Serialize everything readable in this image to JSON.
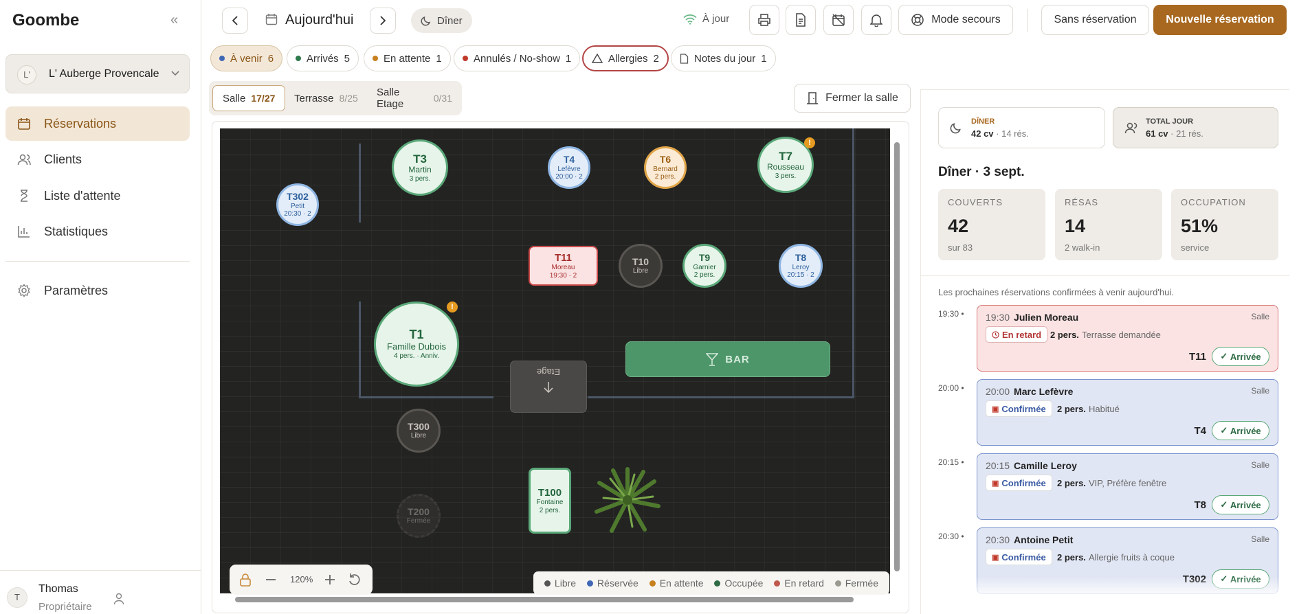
{
  "app": {
    "brand": "Goombe",
    "collapse_icon": "«"
  },
  "venue": {
    "initial": "L'",
    "name": "L' Auberge Provencale"
  },
  "nav": [
    {
      "label": "Réservations",
      "icon": "calendar-icon"
    },
    {
      "label": "Clients",
      "icon": "users-icon"
    },
    {
      "label": "Liste d'attente",
      "icon": "hourglass-icon"
    },
    {
      "label": "Statistiques",
      "icon": "chart-icon"
    },
    {
      "label": "Paramètres",
      "icon": "gear-icon"
    }
  ],
  "user": {
    "initial": "T",
    "name": "Thomas",
    "role": "Propriétaire"
  },
  "topbar": {
    "date": "Aujourd'hui",
    "service": "Dîner",
    "sync": "À jour",
    "rescue": "Mode secours",
    "walkin": "Sans réservation",
    "new": "Nouvelle réservation"
  },
  "filters": [
    {
      "label": "À venir",
      "count": "6",
      "color": "#3f67b5"
    },
    {
      "label": "Arrivés",
      "count": "5",
      "color": "#2f7a4c"
    },
    {
      "label": "En attente",
      "count": "1",
      "color": "#c7801d"
    },
    {
      "label": "Annulés / No-show",
      "count": "1",
      "color": "#c0392b"
    },
    {
      "label": "Allergies",
      "count": "2"
    },
    {
      "label": "Notes du jour",
      "count": "1"
    }
  ],
  "rooms": [
    {
      "label": "Salle",
      "count": "17/27"
    },
    {
      "label": "Terrasse",
      "count": "8/25"
    },
    {
      "label": "Salle Etage",
      "count": "0/31"
    }
  ],
  "close_room": "Fermer la salle",
  "floor": {
    "tables": [
      {
        "id": "T3",
        "name": "Martin",
        "info": "3 pers."
      },
      {
        "id": "T4",
        "name": "Lefèvre",
        "info": "20:00 · 2"
      },
      {
        "id": "T6",
        "name": "Bernard",
        "info": "2 pers."
      },
      {
        "id": "T7",
        "name": "Rousseau",
        "info": "3 pers."
      },
      {
        "id": "T302",
        "name": "Petit",
        "info": "20:30 · 2"
      },
      {
        "id": "T11",
        "name": "Moreau",
        "info": "19:30 · 2"
      },
      {
        "id": "T10",
        "name": "Libre",
        "info": ""
      },
      {
        "id": "T9",
        "name": "Garnier",
        "info": "2 pers."
      },
      {
        "id": "T8",
        "name": "Leroy",
        "info": "20:15 · 2"
      },
      {
        "id": "T1",
        "name": "Famille Dubois",
        "info": "4 pers. · Anniv."
      },
      {
        "id": "T300",
        "name": "Libre",
        "info": ""
      },
      {
        "id": "T200",
        "name": "Fermée",
        "info": ""
      },
      {
        "id": "T100",
        "name": "Fontaine",
        "info": "2 pers."
      }
    ],
    "bar": "BAR",
    "stairs": "Etage",
    "zoom": "120%"
  },
  "legend": [
    {
      "label": "Libre",
      "color": "#555"
    },
    {
      "label": "Réservée",
      "color": "#3f67b5"
    },
    {
      "label": "En attente",
      "color": "#c7801d"
    },
    {
      "label": "Occupée",
      "color": "#2f6b45"
    },
    {
      "label": "En retard",
      "color": "#c0584d"
    },
    {
      "label": "Fermée",
      "color": "#9c9990"
    }
  ],
  "panel": {
    "diner_label": "DÎNER",
    "diner_cv": "42 cv",
    "diner_res": "· 14 rés.",
    "total_label": "TOTAL JOUR",
    "total_cv": "61 cv",
    "total_res": "· 21 rés.",
    "heading": "Dîner · 3 sept.",
    "stats": [
      {
        "label": "COUVERTS",
        "value": "42",
        "detail": "sur 83"
      },
      {
        "label": "RÉSAS",
        "value": "14",
        "detail": "2 walk-in"
      },
      {
        "label": "OCCUPATION",
        "value": "51%",
        "detail": "service"
      }
    ],
    "info": "Les prochaines réservations confirmées à venir aujourd'hui.",
    "reservations": [
      {
        "time": "19:30",
        "name": "Julien Moreau",
        "zone": "Salle",
        "status": "En retard",
        "pers": "2 pers.",
        "note": "Terrasse demandée",
        "table": "T11",
        "action": "Arrivée"
      },
      {
        "time": "20:00",
        "name": "Marc Lefèvre",
        "zone": "Salle",
        "status": "Confirmée",
        "pers": "2 pers.",
        "note": "Habitué",
        "table": "T4",
        "action": "Arrivée"
      },
      {
        "time": "20:15",
        "name": "Camille Leroy",
        "zone": "Salle",
        "status": "Confirmée",
        "pers": "2 pers.",
        "note": "VIP, Préfère fenêtre",
        "table": "T8",
        "action": "Arrivée"
      },
      {
        "time": "20:30",
        "name": "Antoine Petit",
        "zone": "Salle",
        "status": "Confirmée",
        "pers": "2 pers.",
        "note": "Allergie fruits à coque",
        "table": "T302",
        "action": "Arrivée"
      }
    ]
  }
}
